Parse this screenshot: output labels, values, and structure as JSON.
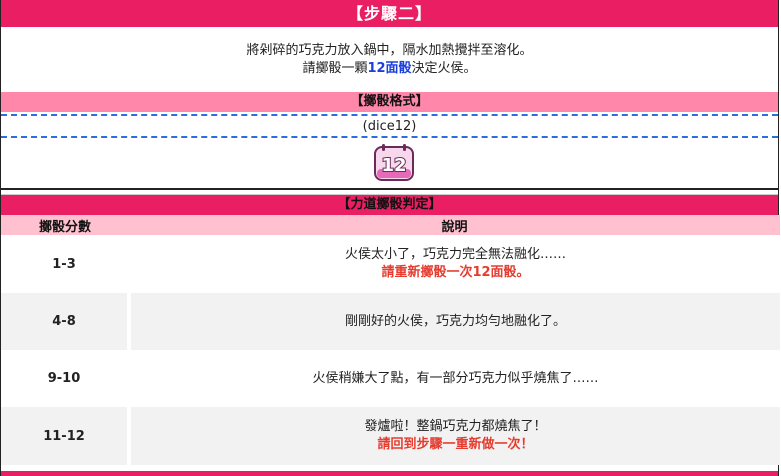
{
  "step": {
    "title": "【步驟二】",
    "line1": "將剁碎的巧克力放入鍋中，隔水加熱攪拌至溶化。",
    "line2_prefix": "請擲骰一顆",
    "line2_highlight": "12面骰",
    "line2_suffix": "決定火侯。"
  },
  "format": {
    "title": "【擲骰格式】",
    "command": "(dice12)",
    "icon": "d12-dice-icon",
    "icon_label": "12"
  },
  "judge": {
    "title": "【力道擲骰判定】",
    "headers": {
      "score": "擲骰分數",
      "desc": "說明"
    },
    "rows": [
      {
        "score": "1-3",
        "desc": "火侯太小了，巧克力完全無法融化……",
        "warn": "請重新擲骰一次12面骰。"
      },
      {
        "score": "4-8",
        "desc": "剛剛好的火侯，巧克力均勻地融化了。",
        "warn": ""
      },
      {
        "score": "9-10",
        "desc": "火侯稍嫌大了點，有一部分巧克力似乎燒焦了……",
        "warn": ""
      },
      {
        "score": "11-12",
        "desc": "發爐啦！整鍋巧克力都燒焦了！",
        "warn": "請回到步驟一重新做一次！"
      }
    ]
  },
  "colors": {
    "accent": "#e91e63",
    "sub_bar": "#ff88aa",
    "header_row": "#ffc0cf",
    "highlight": "#1a3ee0",
    "warn": "#e63c2f"
  }
}
